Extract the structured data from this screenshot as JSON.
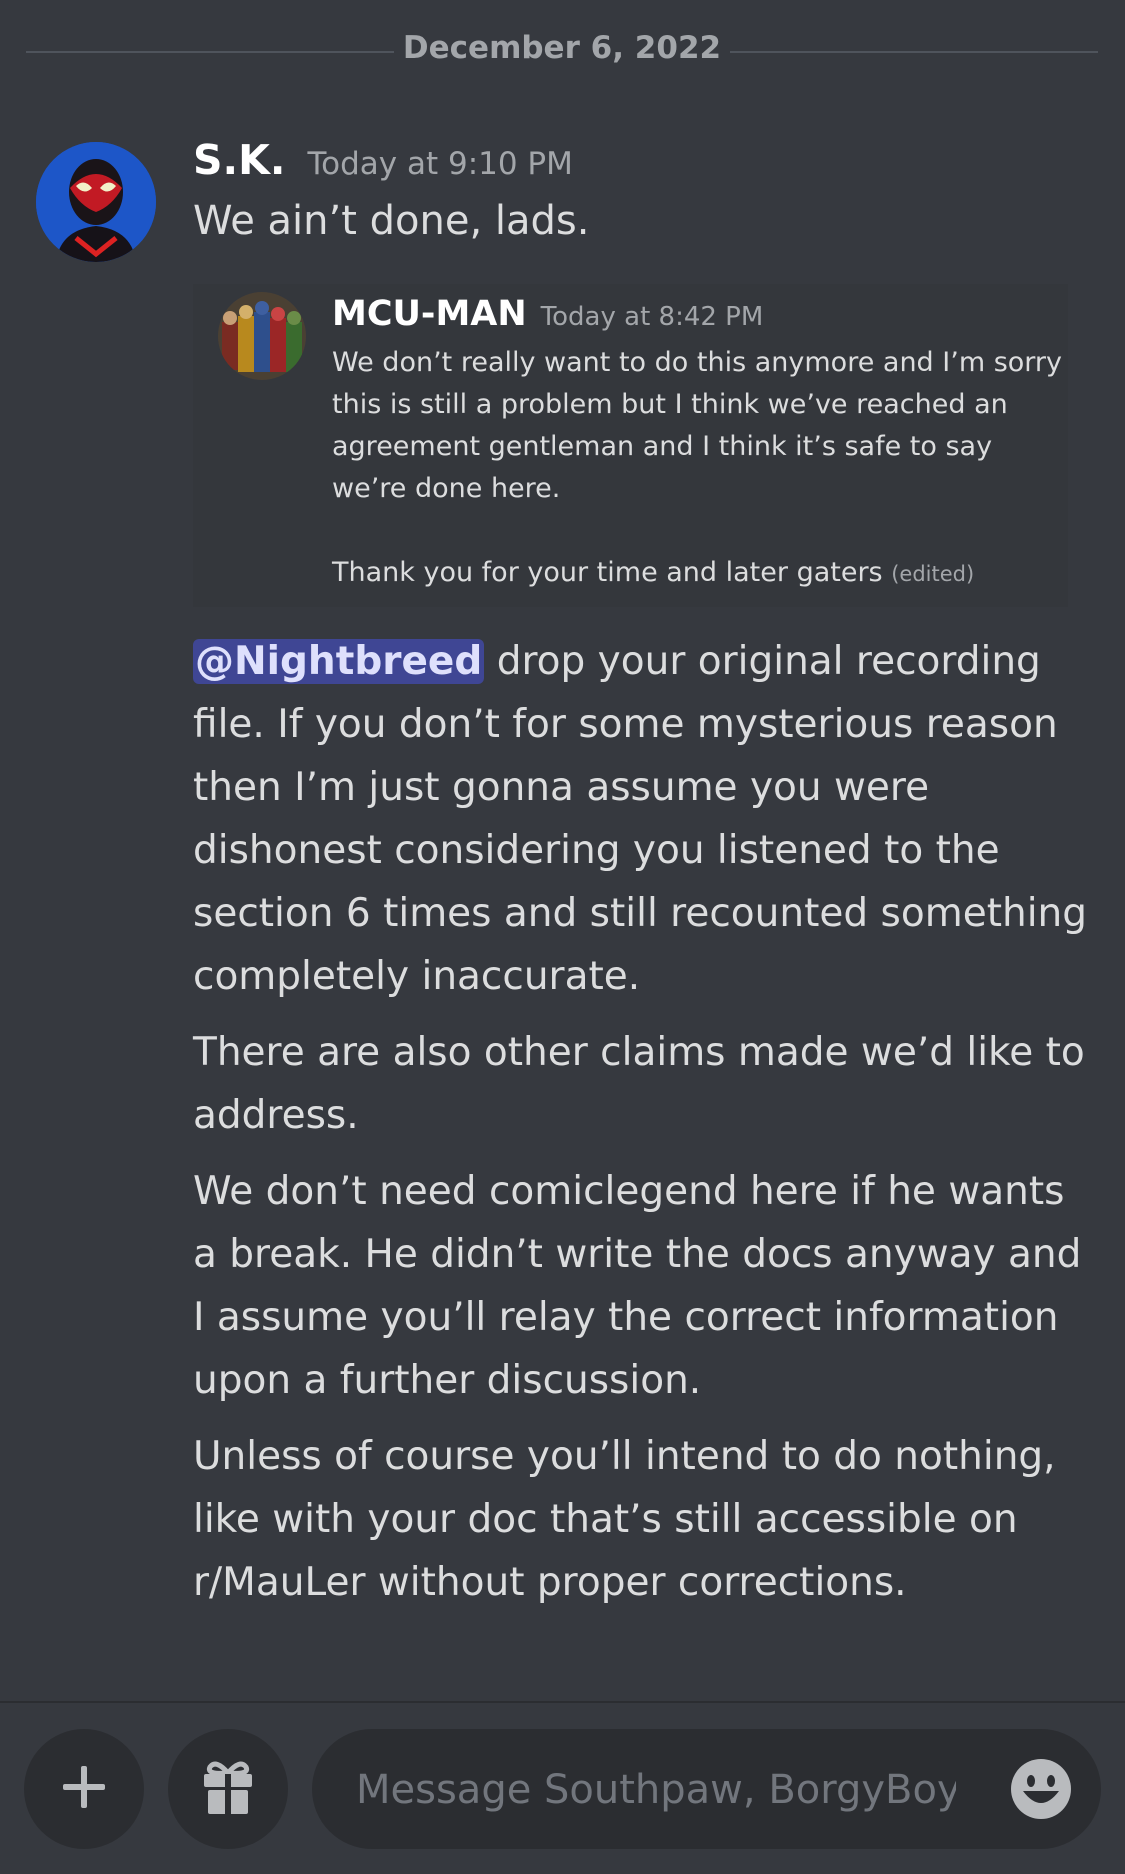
{
  "date_divider": "December 6, 2022",
  "message": {
    "author": "S.K.",
    "timestamp": "Today at 9:10 PM",
    "first_line": "We ain’t done, lads.",
    "embed": {
      "author": "MCU-MAN",
      "timestamp": "Today at 8:42 PM",
      "paragraph1": "We don’t really want to do this anymore and I’m sorry this is still a problem but I think we’ve reached an agreement gentleman and I think it’s safe to say we’re done here.",
      "paragraph2": "Thank you for your time and later gaters",
      "edited_label": "(edited)"
    },
    "mention": "@Nightbreed",
    "mention_followup": " drop your original recording file. If you don’t for some mysterious reason then I’m just gonna assume you were dishonest considering you listened to the section 6 times and still recounted something completely inaccurate.",
    "paragraph2": "There are also other claims made we’d like to address.",
    "paragraph3": "We don’t need comiclegend here if he wants a break. He didn’t write the docs anyway and I assume you’ll relay the correct information upon a further discussion.",
    "paragraph4": "Unless of course you’ll intend to do nothing, like with your doc that’s still accessible on r/MauLer without proper corrections."
  },
  "composer": {
    "placeholder": "Message Southpaw, BorgyBoy…"
  },
  "icons": {
    "add": "plus-icon",
    "gift": "gift-icon",
    "emoji": "smiley-icon"
  },
  "colors": {
    "background": "#36393f",
    "mention_bg": "#3f4694",
    "mention_fg": "#dee0fc"
  }
}
